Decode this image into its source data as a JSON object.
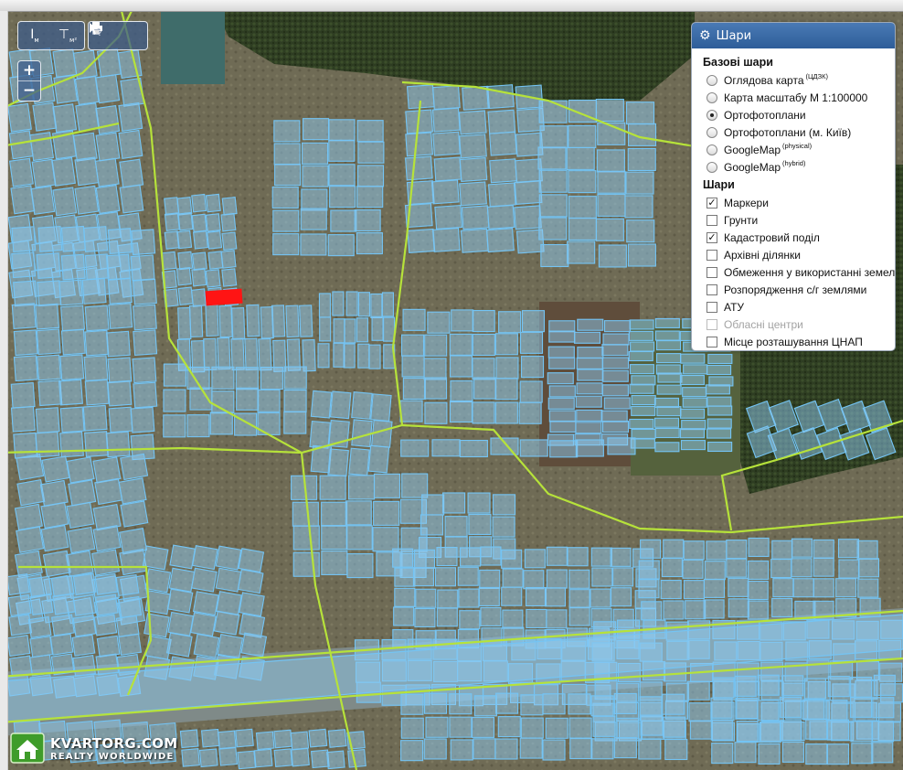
{
  "toolbar": {
    "ruler_label": "I",
    "ruler_unit": "м",
    "area_label": "⊤",
    "area_unit": "м²",
    "print_icon": "printer-icon",
    "identify_icon": "identify-cursor-icon"
  },
  "zoom": {
    "in_label": "+",
    "out_label": "−"
  },
  "layers_panel": {
    "title": "Шари",
    "base_section": "Базові шари",
    "base_layers": [
      {
        "label": "Оглядова карта",
        "sup": "(ЦДЗК)",
        "selected": false
      },
      {
        "label": "Карта масштабу М 1:100000",
        "sup": "",
        "selected": false
      },
      {
        "label": "Ортофотоплани",
        "sup": "",
        "selected": true
      },
      {
        "label": "Ортофотоплани (м. Київ)",
        "sup": "",
        "selected": false
      },
      {
        "label": "GoogleMap",
        "sup": "(physical)",
        "selected": false
      },
      {
        "label": "GoogleMap",
        "sup": "(hybrid)",
        "selected": false
      }
    ],
    "overlay_section": "Шари",
    "overlays": [
      {
        "label": "Маркери",
        "checked": true,
        "disabled": false
      },
      {
        "label": "Грунти",
        "checked": false,
        "disabled": false
      },
      {
        "label": "Кадастровий поділ",
        "checked": true,
        "disabled": false
      },
      {
        "label": "Архівні ділянки",
        "checked": false,
        "disabled": false
      },
      {
        "label": "Обмеження у використанні земель",
        "checked": false,
        "disabled": false
      },
      {
        "label": "Розпорядження с/г землями",
        "checked": false,
        "disabled": false
      },
      {
        "label": "АТУ",
        "checked": false,
        "disabled": false
      },
      {
        "label": "Обласні центри",
        "checked": false,
        "disabled": true
      },
      {
        "label": "Місце розташування ЦНАП",
        "checked": false,
        "disabled": false
      }
    ]
  },
  "watermark": {
    "line1": "KVARTORG.COM",
    "line2": "REALTY WORLDWIDE"
  },
  "colors": {
    "parcel_fill": "#8ec9f0",
    "parcel_stroke": "#74c4f4",
    "boundary_line": "#b6e23a",
    "highlight_parcel": "#ff0000",
    "forest": "#2a3a1f",
    "panel_header": "#3a6aa8"
  }
}
